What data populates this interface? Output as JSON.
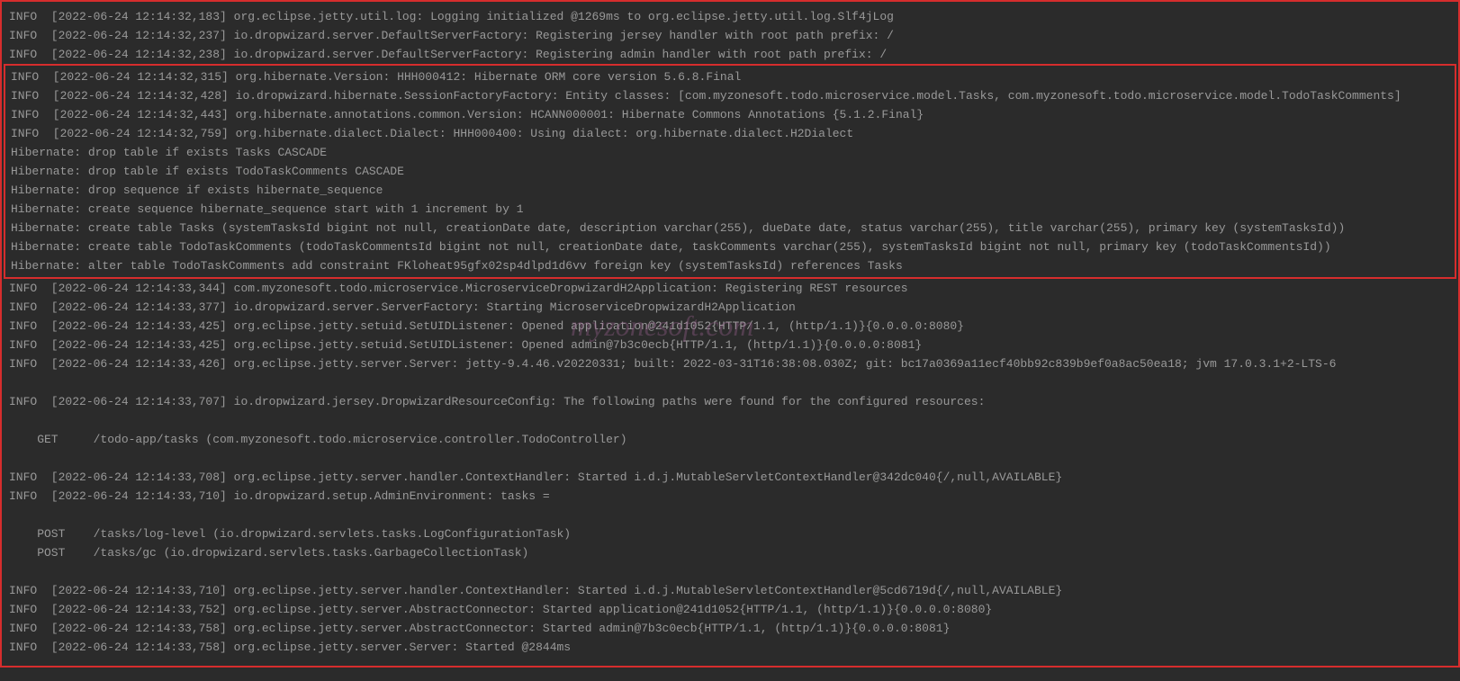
{
  "watermark": "myzonesoft.com",
  "linesBefore": [
    "INFO  [2022-06-24 12:14:32,183] org.eclipse.jetty.util.log: Logging initialized @1269ms to org.eclipse.jetty.util.log.Slf4jLog",
    "INFO  [2022-06-24 12:14:32,237] io.dropwizard.server.DefaultServerFactory: Registering jersey handler with root path prefix: /",
    "INFO  [2022-06-24 12:14:32,238] io.dropwizard.server.DefaultServerFactory: Registering admin handler with root path prefix: /"
  ],
  "linesHighlighted": [
    "INFO  [2022-06-24 12:14:32,315] org.hibernate.Version: HHH000412: Hibernate ORM core version 5.6.8.Final",
    "INFO  [2022-06-24 12:14:32,428] io.dropwizard.hibernate.SessionFactoryFactory: Entity classes: [com.myzonesoft.todo.microservice.model.Tasks, com.myzonesoft.todo.microservice.model.TodoTaskComments]",
    "INFO  [2022-06-24 12:14:32,443] org.hibernate.annotations.common.Version: HCANN000001: Hibernate Commons Annotations {5.1.2.Final}",
    "INFO  [2022-06-24 12:14:32,759] org.hibernate.dialect.Dialect: HHH000400: Using dialect: org.hibernate.dialect.H2Dialect",
    "Hibernate: drop table if exists Tasks CASCADE ",
    "Hibernate: drop table if exists TodoTaskComments CASCADE ",
    "Hibernate: drop sequence if exists hibernate_sequence",
    "Hibernate: create sequence hibernate_sequence start with 1 increment by 1",
    "Hibernate: create table Tasks (systemTasksId bigint not null, creationDate date, description varchar(255), dueDate date, status varchar(255), title varchar(255), primary key (systemTasksId))",
    "Hibernate: create table TodoTaskComments (todoTaskCommentsId bigint not null, creationDate date, taskComments varchar(255), systemTasksId bigint not null, primary key (todoTaskCommentsId))",
    "Hibernate: alter table TodoTaskComments add constraint FKloheat95gfx02sp4dlpd1d6vv foreign key (systemTasksId) references Tasks"
  ],
  "linesAfter": [
    "INFO  [2022-06-24 12:14:33,344] com.myzonesoft.todo.microservice.MicroserviceDropwizardH2Application: Registering REST resources",
    "INFO  [2022-06-24 12:14:33,377] io.dropwizard.server.ServerFactory: Starting MicroserviceDropwizardH2Application",
    "INFO  [2022-06-24 12:14:33,425] org.eclipse.jetty.setuid.SetUIDListener: Opened application@241d1052{HTTP/1.1, (http/1.1)}{0.0.0.0:8080}",
    "INFO  [2022-06-24 12:14:33,425] org.eclipse.jetty.setuid.SetUIDListener: Opened admin@7b3c0ecb{HTTP/1.1, (http/1.1)}{0.0.0.0:8081}",
    "INFO  [2022-06-24 12:14:33,426] org.eclipse.jetty.server.Server: jetty-9.4.46.v20220331; built: 2022-03-31T16:38:08.030Z; git: bc17a0369a11ecf40bb92c839b9ef0a8ac50ea18; jvm 17.0.3.1+2-LTS-6",
    "",
    "INFO  [2022-06-24 12:14:33,707] io.dropwizard.jersey.DropwizardResourceConfig: The following paths were found for the configured resources:",
    "",
    "    GET     /todo-app/tasks (com.myzonesoft.todo.microservice.controller.TodoController)",
    "",
    "INFO  [2022-06-24 12:14:33,708] org.eclipse.jetty.server.handler.ContextHandler: Started i.d.j.MutableServletContextHandler@342dc040{/,null,AVAILABLE}",
    "INFO  [2022-06-24 12:14:33,710] io.dropwizard.setup.AdminEnvironment: tasks = ",
    "",
    "    POST    /tasks/log-level (io.dropwizard.servlets.tasks.LogConfigurationTask)",
    "    POST    /tasks/gc (io.dropwizard.servlets.tasks.GarbageCollectionTask)",
    "",
    "INFO  [2022-06-24 12:14:33,710] org.eclipse.jetty.server.handler.ContextHandler: Started i.d.j.MutableServletContextHandler@5cd6719d{/,null,AVAILABLE}",
    "INFO  [2022-06-24 12:14:33,752] org.eclipse.jetty.server.AbstractConnector: Started application@241d1052{HTTP/1.1, (http/1.1)}{0.0.0.0:8080}",
    "INFO  [2022-06-24 12:14:33,758] org.eclipse.jetty.server.AbstractConnector: Started admin@7b3c0ecb{HTTP/1.1, (http/1.1)}{0.0.0.0:8081}",
    "INFO  [2022-06-24 12:14:33,758] org.eclipse.jetty.server.Server: Started @2844ms"
  ]
}
